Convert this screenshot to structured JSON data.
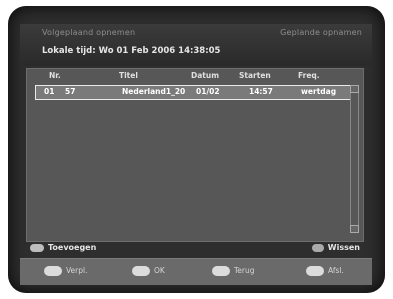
{
  "header": {
    "tab_left": "Volgeplaand opnemen",
    "tab_right": "Geplande opnamen",
    "local_time": "Lokale tijd: Wo 01 Feb 2006 14:38:05"
  },
  "table": {
    "columns": [
      "Nr.",
      "Titel",
      "Datum",
      "Starten",
      "Freq."
    ],
    "rows": [
      {
        "nr": "01",
        "ch": "57",
        "title": "Nederland1_20",
        "date": "01/02",
        "start": "14:57",
        "freq": "wertdag"
      }
    ]
  },
  "actions": {
    "add_label": "Toevoegen",
    "delete_label": "Wissen"
  },
  "footer": {
    "items": [
      {
        "icon": "dpad-icon",
        "label": "Verpl."
      },
      {
        "icon": "ok-icon",
        "label": "OK"
      },
      {
        "icon": "return-icon",
        "label": "Terug"
      },
      {
        "icon": "exit-icon",
        "label": "Afsl."
      }
    ]
  },
  "colors": {
    "background": "#2e2e2e",
    "panel": "#575757",
    "selection_border": "#eaeaea",
    "footer": "#6a6a6a"
  }
}
